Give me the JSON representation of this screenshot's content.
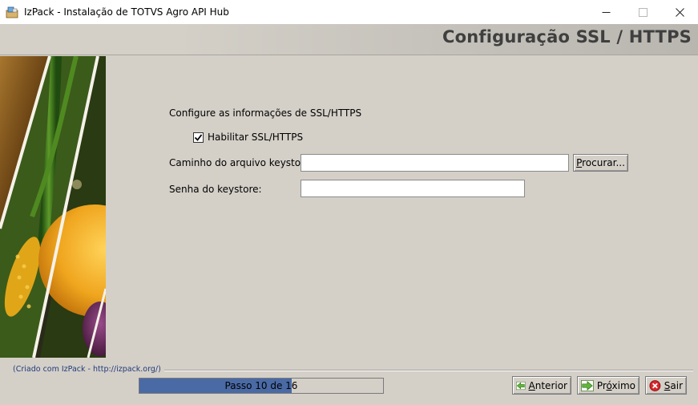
{
  "window": {
    "title": "IzPack - Instalação de TOTVS Agro API Hub",
    "icon": "izpack-app-icon",
    "controls": [
      "minimize-icon",
      "maximize-icon",
      "close-icon"
    ]
  },
  "header": {
    "title": "Configuração SSL / HTTPS"
  },
  "panel": {
    "intro": "Configure as informações de SSL/HTTPS",
    "enable_ssl": {
      "label": "Habilitar SSL/HTTPS",
      "checked": true
    },
    "keystore_path": {
      "label": "Caminho do arquivo keystore:",
      "value": ""
    },
    "browse_button": {
      "label_pre": "",
      "label_accel": "P",
      "label_post": "rocurar..."
    },
    "keystore_password": {
      "label": "Senha do keystore:",
      "value": ""
    }
  },
  "footer": {
    "credit": "(Criado com IzPack - http://izpack.org/)",
    "progress": {
      "text": "Passo 10 de 16",
      "current": 10,
      "total": 16
    },
    "prev_button": {
      "accel": "A",
      "rest": "nterior"
    },
    "next_button": {
      "pre": "Pr",
      "accel": "ó",
      "rest": "ximo"
    },
    "exit_button": {
      "accel": "S",
      "rest": "air"
    }
  },
  "colors": {
    "background": "#d4d0c8",
    "progress_fill": "#4a6aa5",
    "header_text": "#3f3f3f",
    "credit_text": "#233a7a"
  }
}
